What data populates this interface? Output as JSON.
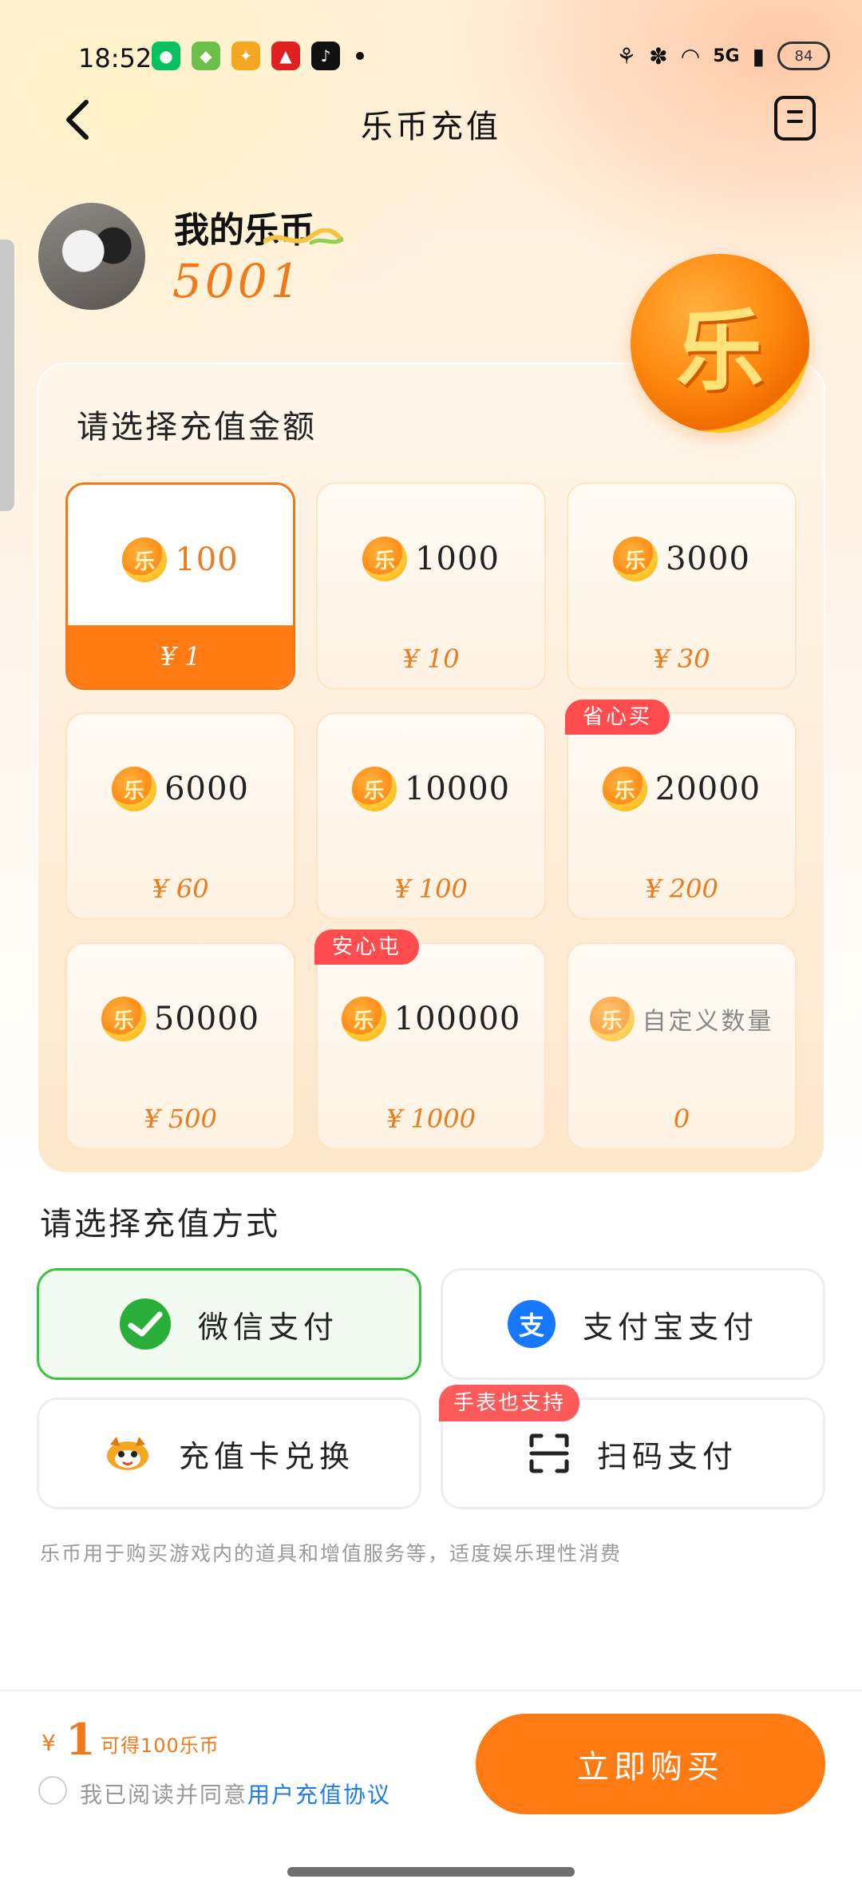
{
  "status_bar": {
    "time": "18:52",
    "network": "5G",
    "battery": "84"
  },
  "nav": {
    "title": "乐币充值",
    "back_icon": "chevron-left-icon",
    "menu_icon": "menu-icon"
  },
  "profile": {
    "label": "我的乐币",
    "coins": "5001"
  },
  "big_coin_glyph": "乐",
  "amount_section": {
    "title": "请选择充值金额",
    "coin_glyph": "乐",
    "options": [
      {
        "coins": "100",
        "price": "¥ 1",
        "selected": true
      },
      {
        "coins": "1000",
        "price": "¥ 10"
      },
      {
        "coins": "3000",
        "price": "¥ 30"
      },
      {
        "coins": "6000",
        "price": "¥ 60"
      },
      {
        "coins": "10000",
        "price": "¥ 100"
      },
      {
        "coins": "20000",
        "price": "¥ 200",
        "tag": "省心买"
      },
      {
        "coins": "50000",
        "price": "¥ 500"
      },
      {
        "coins": "100000",
        "price": "¥ 1000",
        "tag": "安心屯"
      },
      {
        "coins": "自定义数量",
        "price": "0",
        "custom": true
      }
    ]
  },
  "payment": {
    "title": "请选择充值方式",
    "methods": [
      {
        "label": "微信支付",
        "icon": "wechat-icon",
        "selected": true
      },
      {
        "label": "支付宝支付",
        "icon": "alipay-icon",
        "icon_glyph": "支"
      },
      {
        "label": "充值卡兑换",
        "icon": "mascot-icon"
      },
      {
        "label": "扫码支付",
        "icon": "scan-icon",
        "tag": "手表也支持"
      }
    ]
  },
  "note": "乐币用于购买游戏内的道具和增值服务等，适度娱乐理性消费",
  "footer": {
    "currency": "¥",
    "amount": "1",
    "desc": "可得100乐币",
    "agree_prefix": "我已阅读并同意",
    "agree_link": "用户充值协议",
    "buy_label": "立即购买"
  },
  "colors": {
    "accent": "#ff7a12",
    "selected_pay": "#3cc43e",
    "tag": "#ff4d4f",
    "link": "#1a7cf0"
  }
}
